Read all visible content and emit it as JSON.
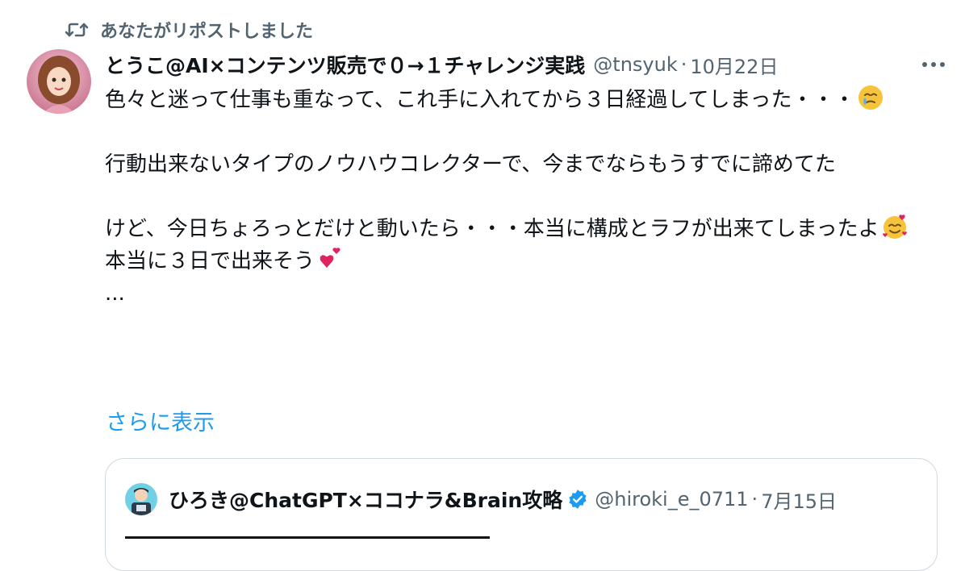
{
  "repost": {
    "label": "あなたがリポストしました",
    "icon": "repost-icon"
  },
  "author": {
    "name": "とうこ@AI×コンテンツ販売で０→１チャレンジ実践",
    "handle": "@tnsyuk",
    "date": "10月22日",
    "separator": "·"
  },
  "tweet": {
    "paragraphs": [
      "色々と迷って仕事も重なって、これ手に入れてから３日経過してしまった・・・",
      "行動出来ないタイプのノウハウコレクターで、今までならもうすでに諦めてた",
      "けど、今日ちょろっとだけと動いたら・・・本当に構成とラフが出来てしまったよ",
      "本当に３日で出来そう",
      "..."
    ],
    "emojis": [
      "face-holding-back-tears-emoji",
      "smiling-face-with-hearts-emoji",
      "two-hearts-emoji"
    ]
  },
  "show_more": "さらに表示",
  "quote": {
    "name": "ひろき@ChatGPT×ココナラ&Brain攻略",
    "handle": "@hiroki_e_0711",
    "date": "7月15日",
    "separator": "·",
    "verified_icon": "verified-badge-icon"
  },
  "colors": {
    "accent": "#1d9bf0",
    "secondary_text": "#536471",
    "border": "#cfd9de"
  }
}
